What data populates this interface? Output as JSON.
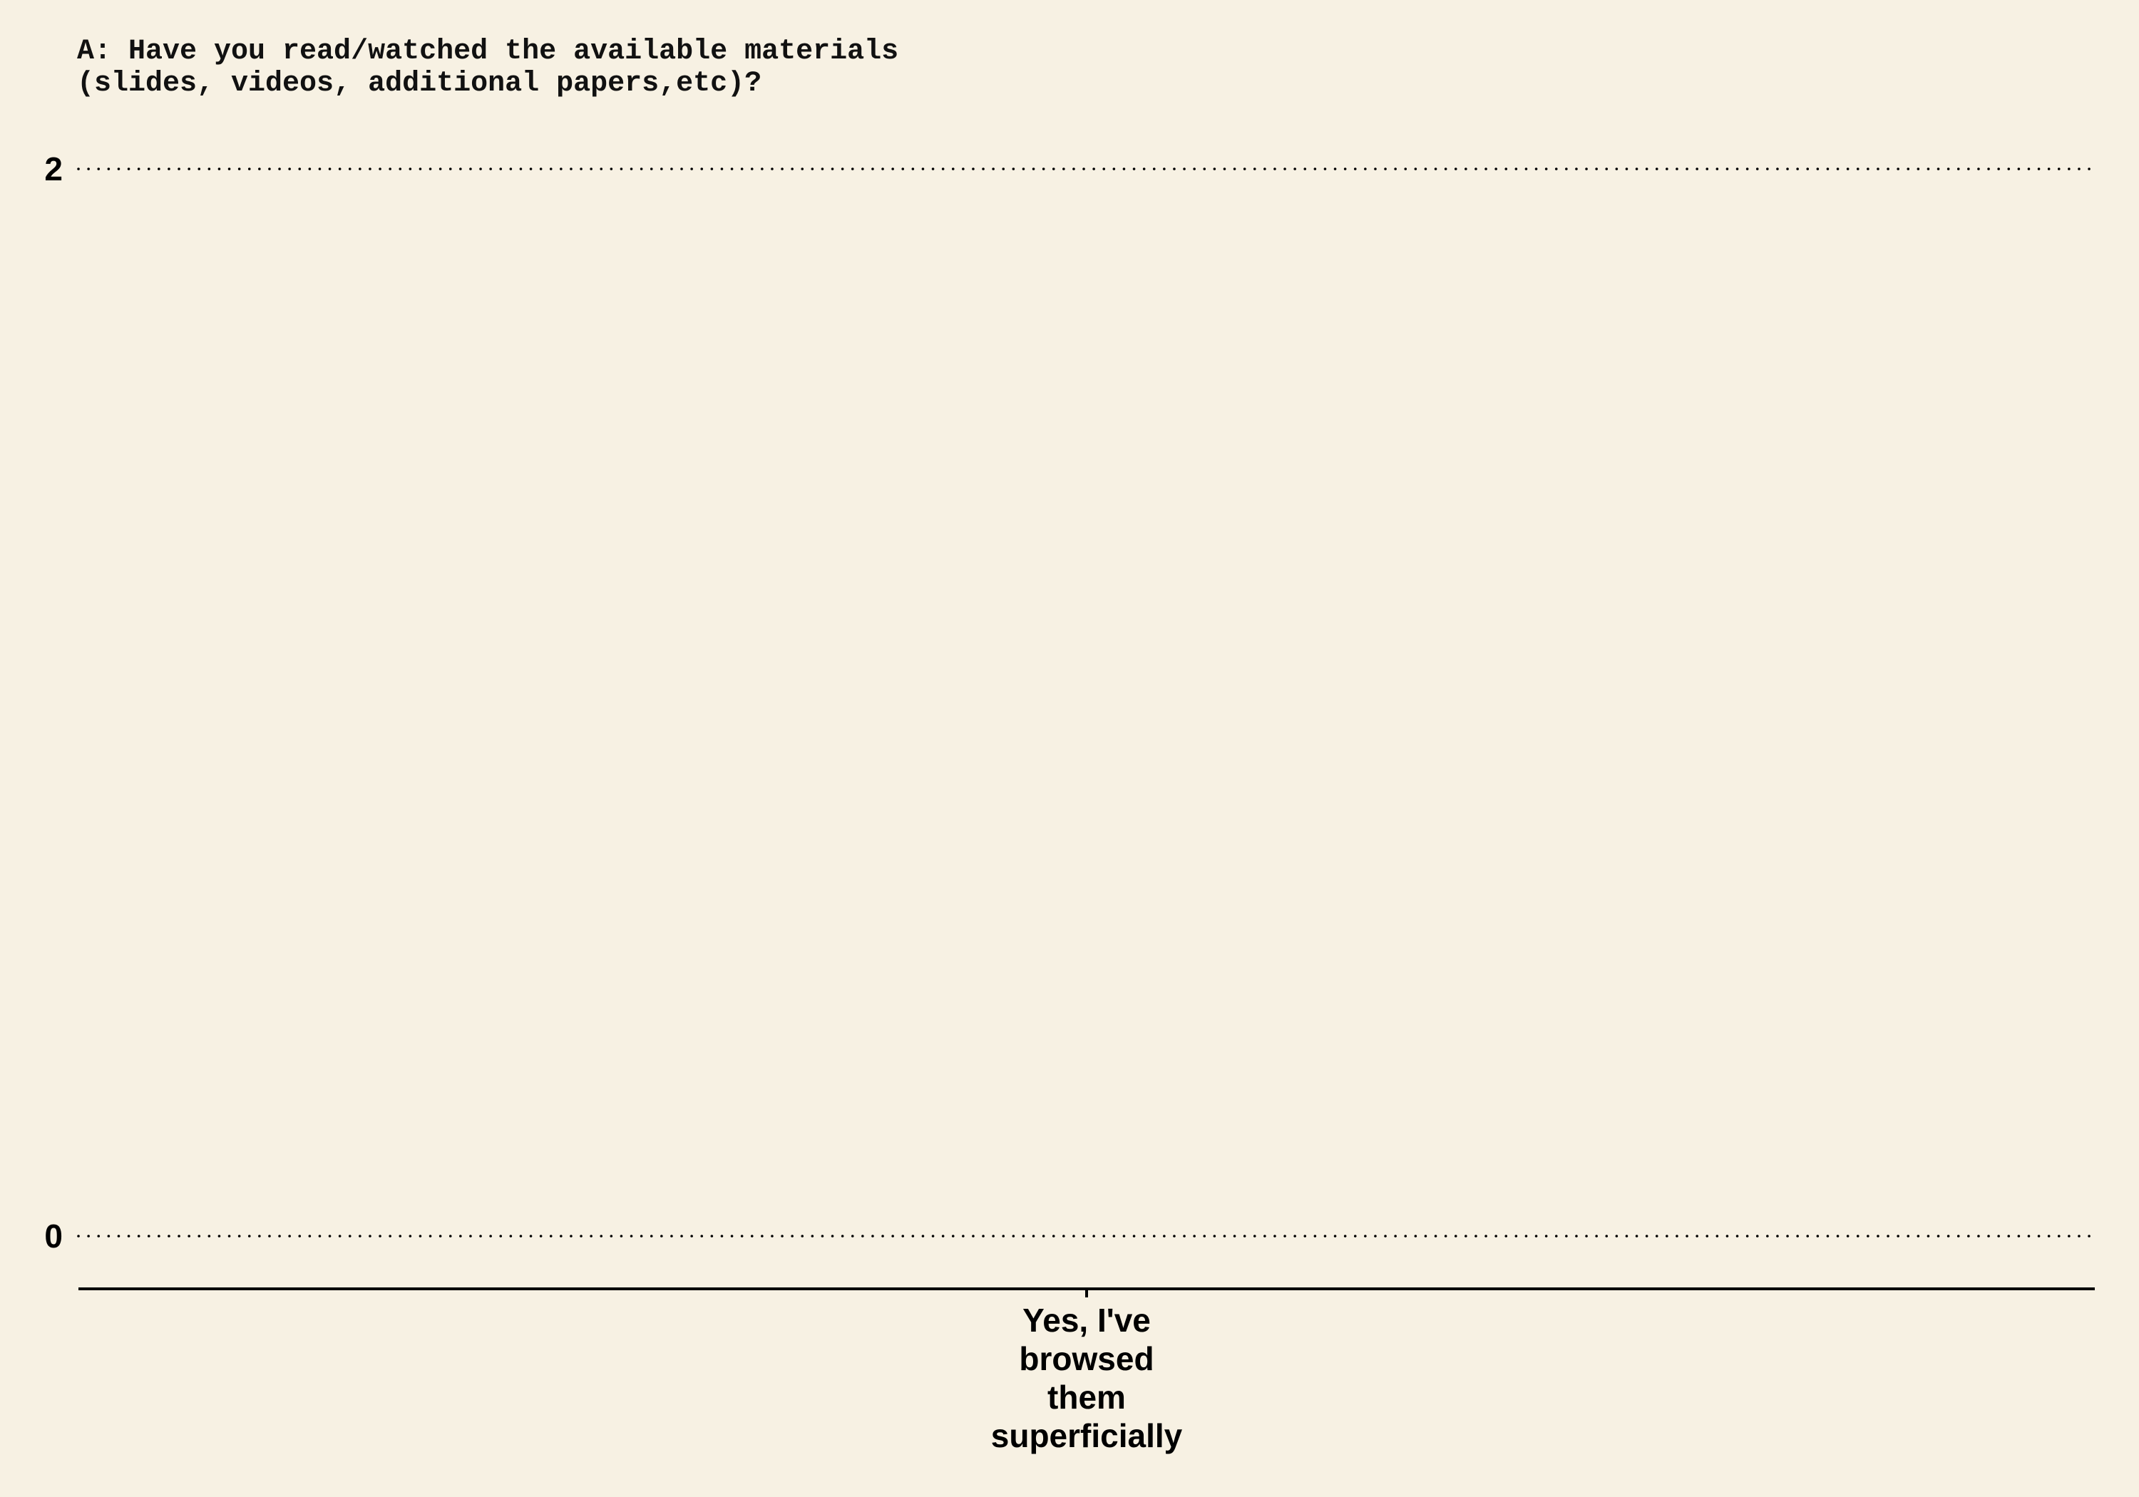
{
  "colors": {
    "background": "#f7f1e3",
    "text": "#000000",
    "grid": "#000000"
  },
  "chart_data": {
    "type": "bar",
    "title": "A: Have you read/watched the available materials\n(slides, videos, additional papers,etc)?",
    "xlabel": "",
    "ylabel": "",
    "categories": [
      "Yes, I've browsed them superficially"
    ],
    "category_label_lines": [
      [
        "Yes, I've",
        "browsed",
        "them",
        "superficially"
      ]
    ],
    "values": [
      0
    ],
    "ylim": [
      0,
      2
    ],
    "yticks": [
      0,
      2
    ],
    "ytick_labels": [
      "0",
      "2"
    ],
    "grid": "horizontal-dotted",
    "legend": "none"
  }
}
